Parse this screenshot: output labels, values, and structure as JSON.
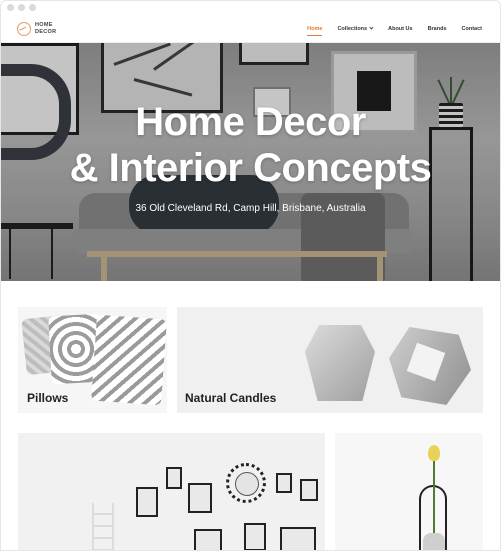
{
  "brand": {
    "line1": "HOME",
    "line2": "DECOR",
    "accent": "#e07a3b"
  },
  "nav": {
    "items": [
      {
        "label": "Home",
        "active": true
      },
      {
        "label": "Collections",
        "has_dropdown": true
      },
      {
        "label": "About Us"
      },
      {
        "label": "Brands"
      },
      {
        "label": "Contact"
      }
    ]
  },
  "hero": {
    "title_line1": "Home Decor",
    "title_line2": "& Interior Concepts",
    "address": "36 Old Cleveland Rd, Camp Hill, Brisbane, Australia"
  },
  "categories": [
    {
      "label": "Pillows"
    },
    {
      "label": "Natural Candles"
    },
    {
      "label": ""
    },
    {
      "label": ""
    }
  ],
  "icons": [
    "logo-icon",
    "chevron-down-icon"
  ]
}
